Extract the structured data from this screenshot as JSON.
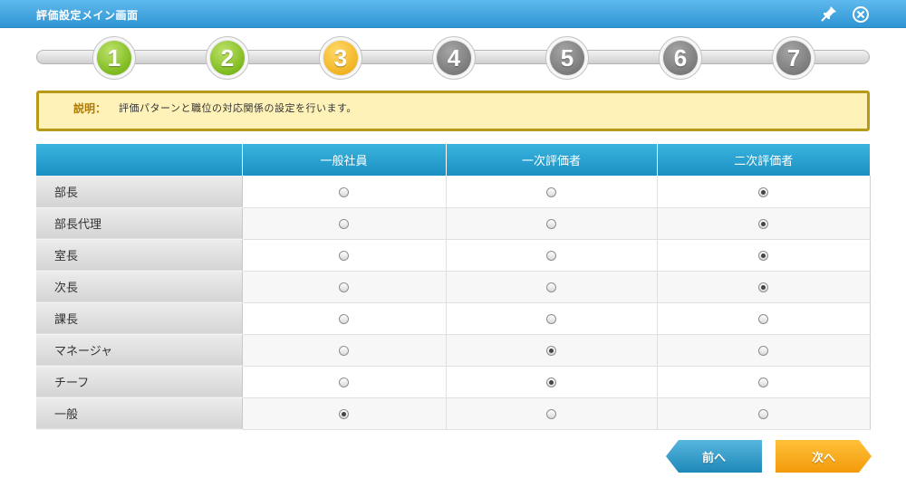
{
  "window": {
    "title": "評価設定メイン画面",
    "pin_icon": "pin-icon",
    "close_icon": "close-icon"
  },
  "stepper": {
    "steps": [
      {
        "label": "1",
        "state": "done"
      },
      {
        "label": "2",
        "state": "done"
      },
      {
        "label": "3",
        "state": "current"
      },
      {
        "label": "4",
        "state": "todo"
      },
      {
        "label": "5",
        "state": "todo"
      },
      {
        "label": "6",
        "state": "todo"
      },
      {
        "label": "7",
        "state": "todo"
      }
    ],
    "colors": {
      "done": "#8cc63f",
      "current": "#f7b92b",
      "todo": "#7f7f7f"
    }
  },
  "description": {
    "label": "説明：",
    "text": "評価パターンと職位の対応関係の設定を行います。"
  },
  "table": {
    "columns": [
      "",
      "一般社員",
      "一次評価者",
      "二次評価者"
    ],
    "rows": [
      {
        "label": "部長",
        "selected": 2
      },
      {
        "label": "部長代理",
        "selected": 2
      },
      {
        "label": "室長",
        "selected": 2
      },
      {
        "label": "次長",
        "selected": 2
      },
      {
        "label": "課長",
        "selected": -1
      },
      {
        "label": "マネージャ",
        "selected": 1
      },
      {
        "label": "チーフ",
        "selected": 1
      },
      {
        "label": "一般",
        "selected": 0
      }
    ]
  },
  "buttons": {
    "prev_label": "前へ",
    "next_label": "次へ"
  }
}
